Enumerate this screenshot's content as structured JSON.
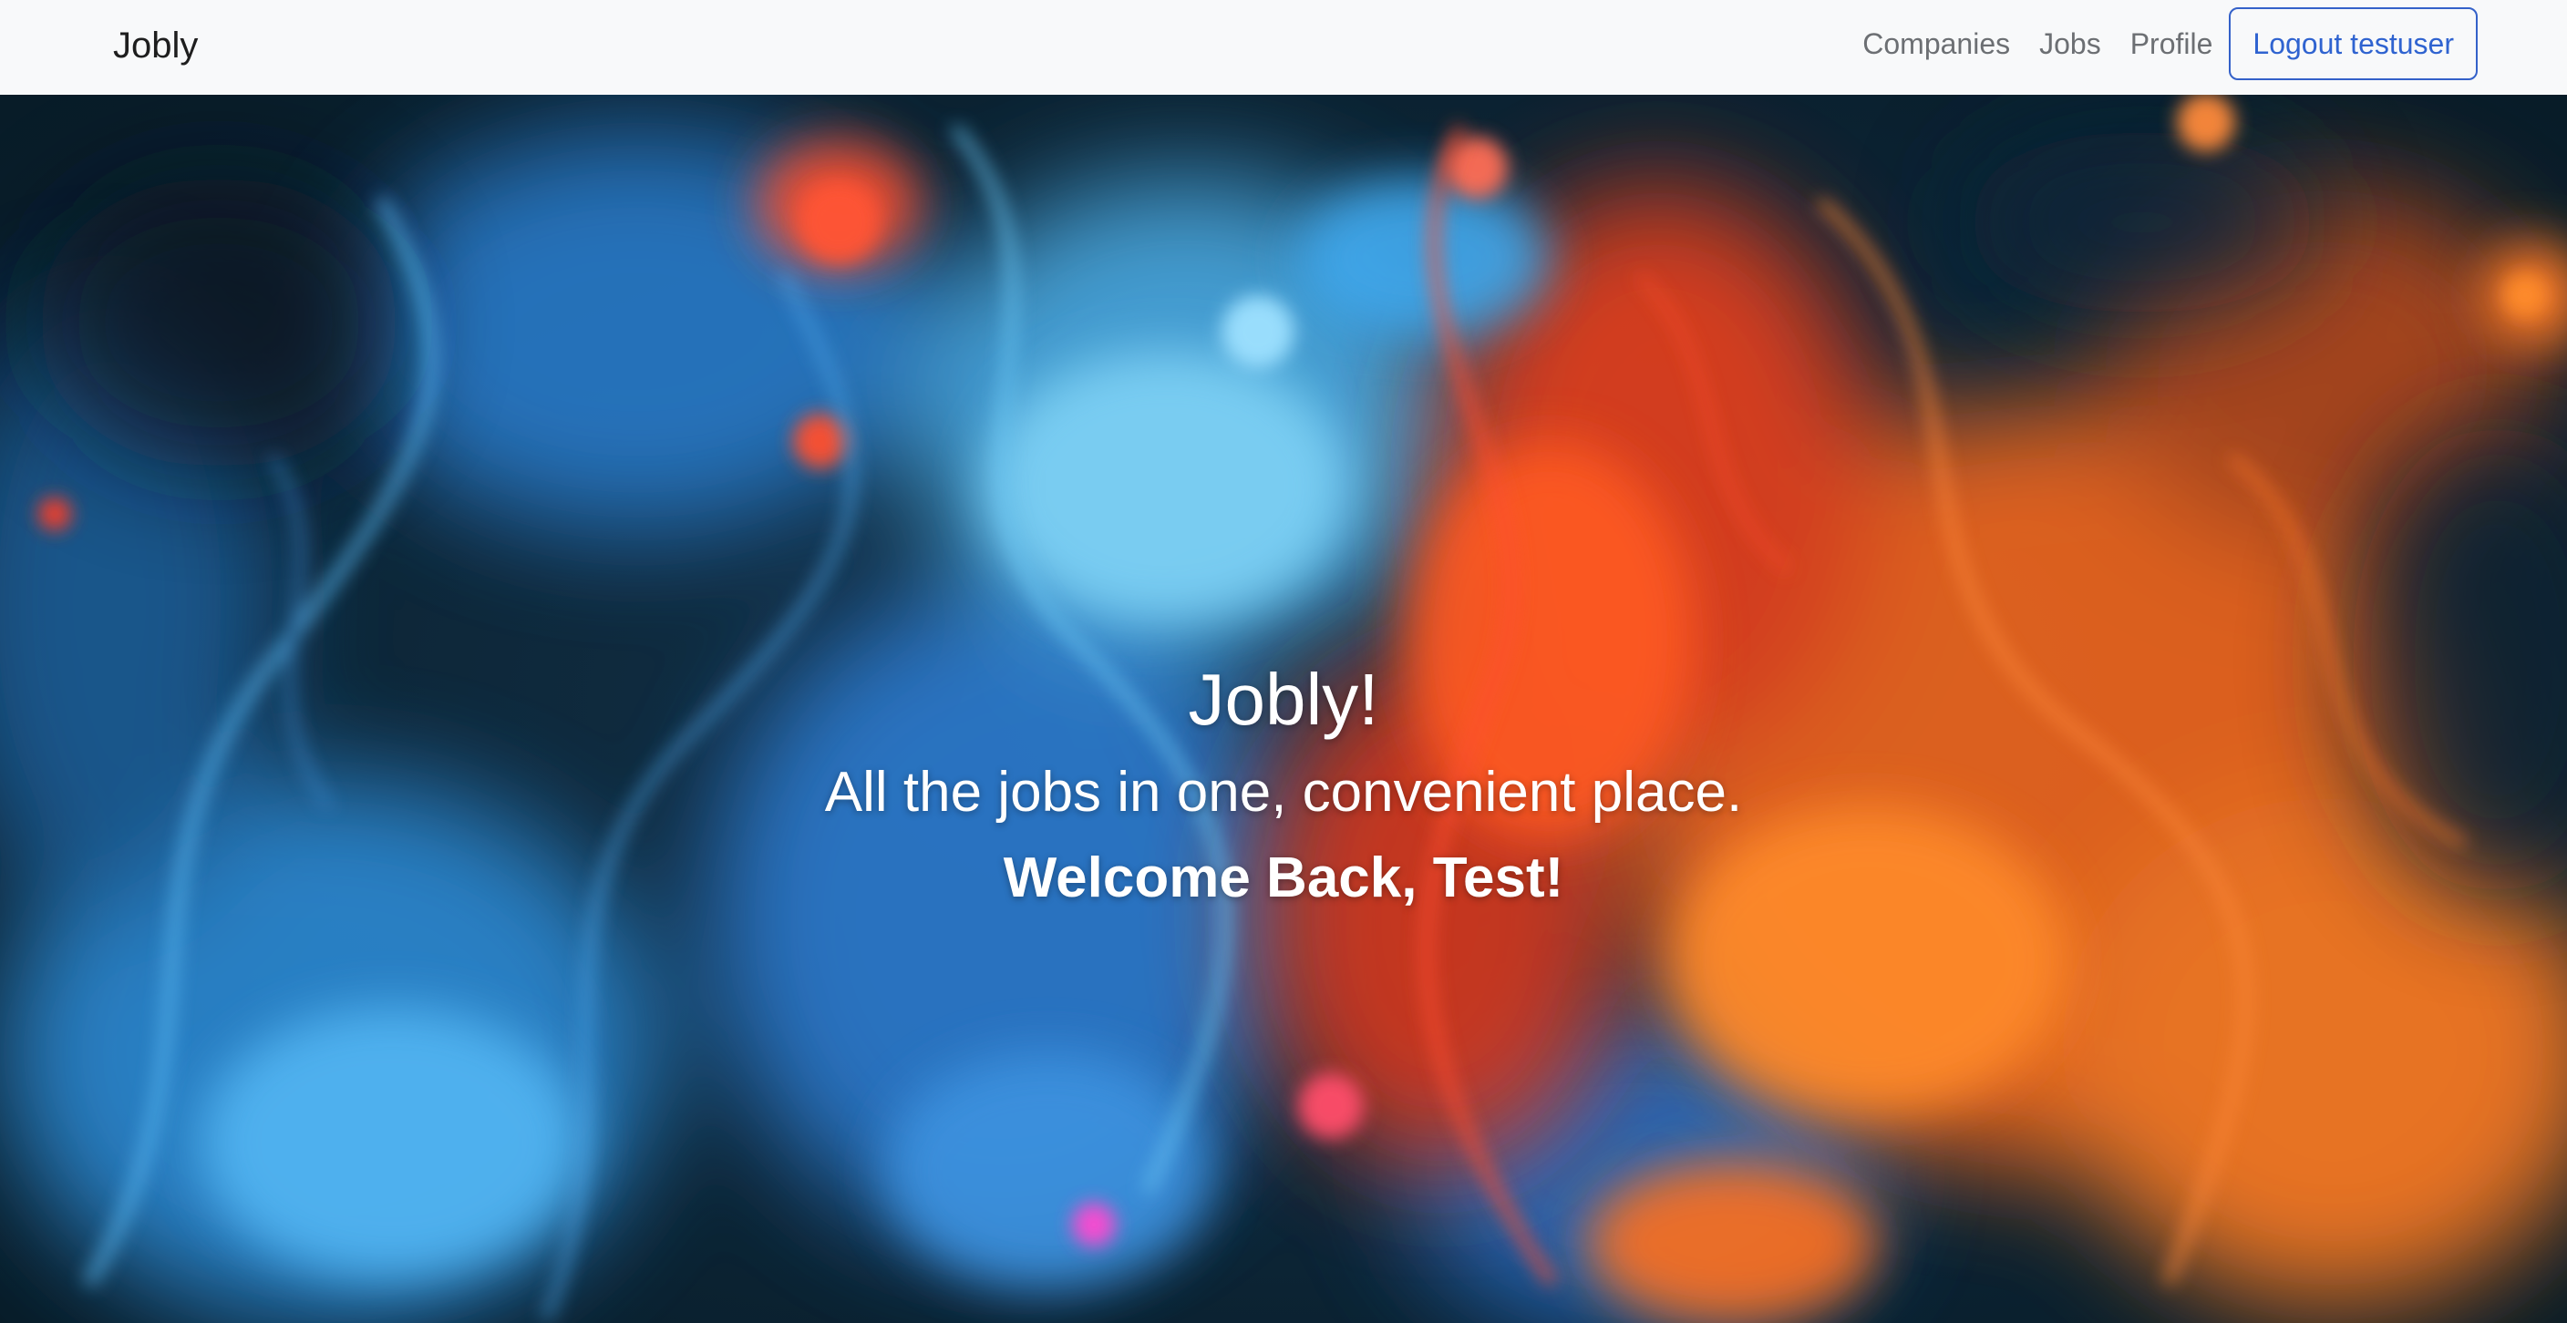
{
  "navbar": {
    "brand": "Jobly",
    "links": [
      "Companies",
      "Jobs",
      "Profile"
    ],
    "logout_label": "Logout testuser"
  },
  "hero": {
    "title": "Jobly!",
    "tagline": "All the jobs in one, convenient place.",
    "welcome": "Welcome Back, Test!",
    "background": "abstract-ink-smoke-image"
  },
  "colors": {
    "navbar_bg": "#f8f9fa",
    "link": "#6c6f73",
    "accent": "#2f63d0",
    "hero_text": "#ffffff"
  }
}
